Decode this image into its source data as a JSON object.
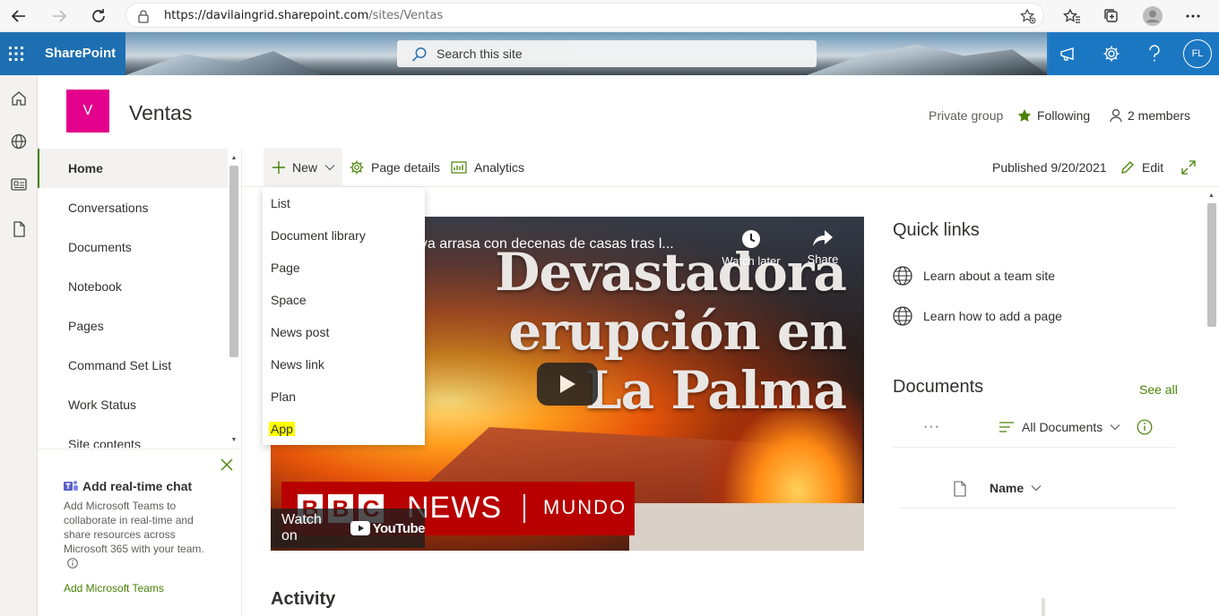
{
  "browser": {
    "url_host": "https://davilaingrid.sharepoint.com",
    "url_path": "/sites/Ventas"
  },
  "suite": {
    "brand": "SharePoint",
    "search_placeholder": "Search this site",
    "avatar_initials": "FL"
  },
  "site": {
    "logo_letter": "V",
    "title": "Ventas",
    "privacy": "Private group",
    "following": "Following",
    "members": "2 members"
  },
  "nav": {
    "items": [
      {
        "label": "Home"
      },
      {
        "label": "Conversations"
      },
      {
        "label": "Documents"
      },
      {
        "label": "Notebook"
      },
      {
        "label": "Pages"
      },
      {
        "label": "Command Set List"
      },
      {
        "label": "Work Status"
      },
      {
        "label": "Site contents"
      }
    ]
  },
  "teams_card": {
    "title": "Add real-time chat",
    "description": "Add Microsoft Teams to collaborate in real-time and share resources across Microsoft 365 with your team.",
    "link": "Add Microsoft Teams"
  },
  "commandbar": {
    "new_label": "New",
    "page_details": "Page details",
    "analytics": "Analytics",
    "published": "Published 9/20/2021",
    "edit": "Edit"
  },
  "new_menu": {
    "items": [
      {
        "label": "List"
      },
      {
        "label": "Document library"
      },
      {
        "label": "Page"
      },
      {
        "label": "Space"
      },
      {
        "label": "News post"
      },
      {
        "label": "News link"
      },
      {
        "label": "Plan"
      },
      {
        "label": "App"
      }
    ]
  },
  "video": {
    "title": "ava arrasa con decenas de casas tras l...",
    "watch_later": "Watch later",
    "share": "Share",
    "headline_1": "Devastadora",
    "headline_2": "erupción en",
    "headline_3": "La Palma",
    "bbc_news": "NEWS",
    "bbc_mundo": "MUNDO",
    "watch_on": "Watch on",
    "youtube": "YouTube"
  },
  "activity": {
    "heading": "Activity"
  },
  "quick_links": {
    "heading": "Quick links",
    "items": [
      {
        "label": "Learn about a team site"
      },
      {
        "label": "Learn how to add a page"
      }
    ]
  },
  "documents": {
    "heading": "Documents",
    "see_all": "See all",
    "more": "···",
    "view": "All Documents",
    "column_name": "Name"
  },
  "colors": {
    "suite_blue": "#1d6fb1",
    "accent_green": "#498205",
    "logo_magenta": "#e3008c",
    "highlight": "#ffff00"
  }
}
